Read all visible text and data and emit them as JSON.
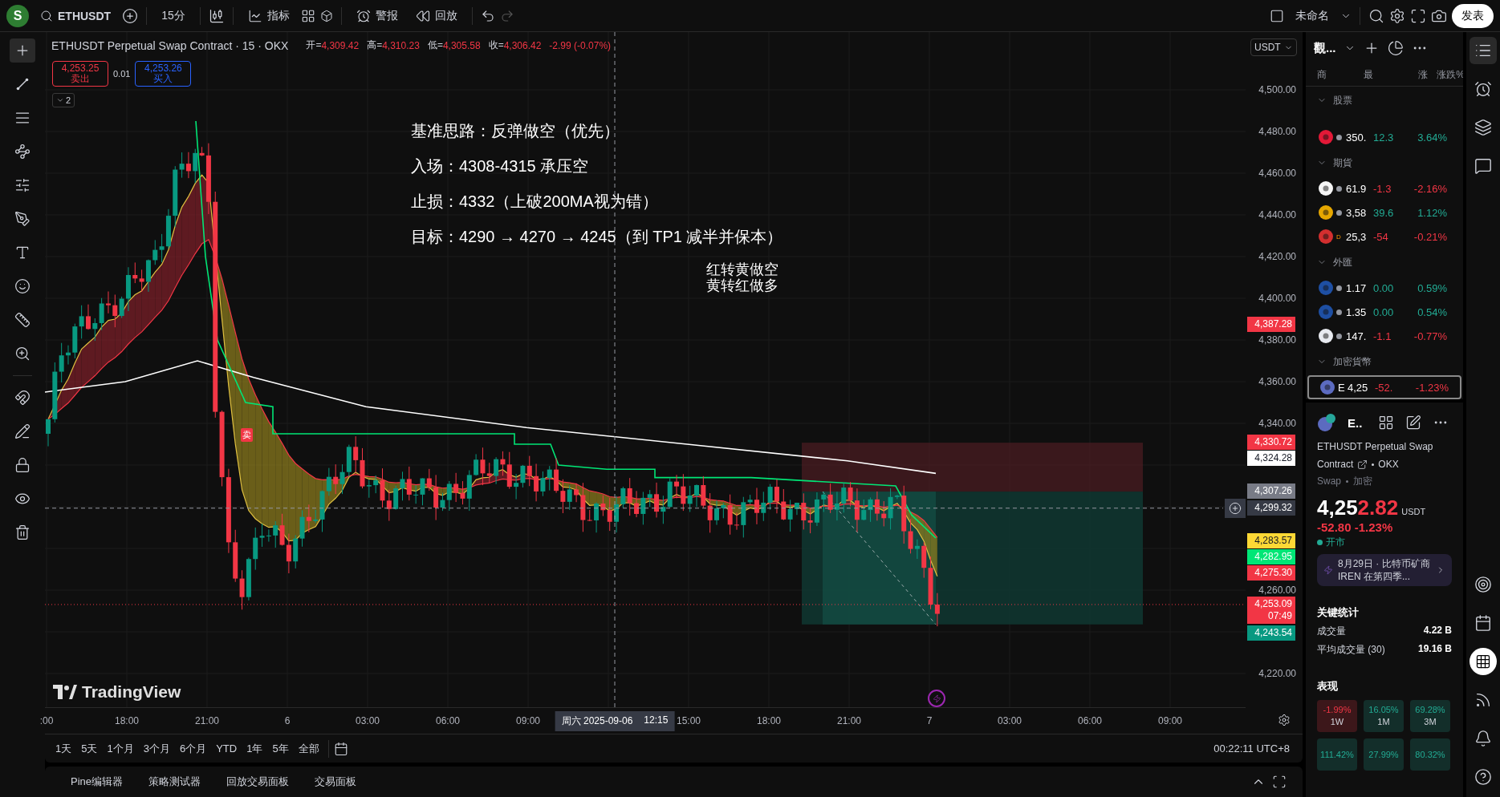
{
  "top_bar": {
    "avatar": "S",
    "symbol": "ETHUSDT",
    "interval": "15分",
    "indicators": "指标",
    "alert": "警报",
    "replay": "回放",
    "layout_name": "未命名",
    "publish": "发表"
  },
  "legend": {
    "title": "ETHUSDT Perpetual Swap Contract · 15 · OKX",
    "ohlc": [
      {
        "label": "开=",
        "value": "4,309.42"
      },
      {
        "label": "高=",
        "value": "4,310.23"
      },
      {
        "label": "低=",
        "value": "4,305.58"
      },
      {
        "label": "收=",
        "value": "4,306.42"
      }
    ],
    "change": "-2.99 (-0.07%)"
  },
  "trade": {
    "sell_price": "4,253.25",
    "sell_label": "卖出",
    "spread": "0.01",
    "buy_price": "4,253.26",
    "buy_label": "买入",
    "collapsed_count": "2"
  },
  "notes": [
    "基准思路：反弹做空（优先）",
    "入场：4308-4315 承压空",
    "止损：4332（上破200MA视为错）",
    "目标：4290 → 4270 → 4245（到 TP1 减半并保本）"
  ],
  "signal_note": [
    "红转黄做空",
    "黄转红做多"
  ],
  "sell_marker": "卖",
  "watermark_logo": "TradingView",
  "price_axis": {
    "currency": "USDT",
    "ticks": [
      "4,500.00",
      "4,480.00",
      "4,460.00",
      "4,440.00",
      "4,420.00",
      "4,400.00",
      "4,380.00",
      "4,360.00",
      "4,340.00",
      "4,260.00",
      "4,220.00"
    ],
    "badges": [
      {
        "price": "4,387.28",
        "color": "#f23645"
      },
      {
        "price": "4,330.72",
        "color": "#f23645"
      },
      {
        "price": "4,324.28",
        "color": "#ffffff"
      },
      {
        "price": "4,307.26",
        "color": "#787b86"
      },
      {
        "price": "4,299.32",
        "color": "#363a45"
      },
      {
        "price": "4,283.57",
        "color": "#fdd835"
      },
      {
        "price": "4,282.95",
        "color": "#00e676"
      },
      {
        "price": "4,275.30",
        "color": "#f23645"
      },
      {
        "price": "4,253.09",
        "sub": "07:49",
        "color": "#f23645"
      },
      {
        "price": "4,243.54",
        "color": "#089981"
      }
    ]
  },
  "time_axis": [
    {
      "label": ":00",
      "kind": "tick"
    },
    {
      "label": "18:00",
      "kind": "tick"
    },
    {
      "label": "21:00",
      "kind": "tick"
    },
    {
      "label": "6",
      "kind": "tick"
    },
    {
      "label": "03:00",
      "kind": "tick"
    },
    {
      "label": "06:00",
      "kind": "tick"
    },
    {
      "label": "09:00",
      "kind": "tick"
    },
    {
      "label": "周六 2025-09-06",
      "time": "12:15",
      "kind": "crosshair"
    },
    {
      "label": "15:00",
      "kind": "tick"
    },
    {
      "label": "18:00",
      "kind": "tick"
    },
    {
      "label": "21:00",
      "kind": "tick"
    },
    {
      "label": "7",
      "kind": "tick"
    },
    {
      "label": "03:00",
      "kind": "tick"
    },
    {
      "label": "06:00",
      "kind": "tick"
    },
    {
      "label": "09:00",
      "kind": "tick"
    }
  ],
  "ranges": [
    "1天",
    "5天",
    "1个月",
    "3个月",
    "6个月",
    "YTD",
    "1年",
    "5年",
    "全部"
  ],
  "clock": "00:22:11 UTC+8",
  "bottom_tabs": [
    "Pine编辑器",
    "策略测试器",
    "回放交易面板",
    "交易面板"
  ],
  "watchlist": {
    "title": "觀...",
    "columns": [
      "商",
      "最",
      "涨",
      "涨跌%"
    ],
    "sections": [
      {
        "name": "股票",
        "rows": [
          {
            "symbol": "",
            "last": "350.",
            "chg": "12.3",
            "pct": "3.64%",
            "color": "#22ab94",
            "selected": false
          }
        ]
      },
      {
        "name": "期貨",
        "rows": [
          {
            "symbol": "",
            "last": "61.9",
            "chg": "-1.3",
            "pct": "-2.16%",
            "color": "#f23645",
            "selected": false
          },
          {
            "symbol": "",
            "last": "3,58",
            "chg": "39.6",
            "pct": "1.12%",
            "color": "#22ab94",
            "selected": false
          },
          {
            "symbol": "",
            "flag": "D",
            "last": "25,3",
            "chg": "-54",
            "pct": "-0.21%",
            "color": "#f23645",
            "selected": false
          }
        ]
      },
      {
        "name": "外匯",
        "rows": [
          {
            "symbol": "",
            "last": "1.17",
            "chg": "0.00",
            "pct": "0.59%",
            "color": "#22ab94",
            "selected": false
          },
          {
            "symbol": "",
            "last": "1.35",
            "chg": "0.00",
            "pct": "0.54%",
            "color": "#22ab94",
            "selected": false
          },
          {
            "symbol": "",
            "last": "147.",
            "chg": "-1.1",
            "pct": "-0.77%",
            "color": "#f23645",
            "selected": false
          }
        ]
      },
      {
        "name": "加密貨幣",
        "rows": [
          {
            "symbol": "E",
            "last": "4,25",
            "chg": "-52.",
            "pct": "-1.23%",
            "color": "#f23645",
            "selected": true
          }
        ]
      }
    ]
  },
  "details": {
    "symbol": "E..",
    "name": "ETHUSDT Perpetual Swap",
    "name_2": "Contract",
    "exchange": "OKX",
    "type": "Swap",
    "category": "加密",
    "price_main": "4,25",
    "price_tail": "2.82",
    "currency": "USDT",
    "change": "-52.80  -1.23%",
    "status": "开市",
    "news": "8月29日 · 比特币矿商 IREN 在第四季...",
    "stats_title": "关键统计",
    "stats": [
      {
        "label": "成交量",
        "value": "4.22 B"
      },
      {
        "label": "平均成交量 (30)",
        "value": "19.16 B"
      }
    ],
    "performance_title": "表现",
    "performance": [
      {
        "value": "-1.99%",
        "period": "1W",
        "color": "#f23645"
      },
      {
        "value": "16.05%",
        "period": "1M",
        "color": "#22ab94"
      },
      {
        "value": "69.28%",
        "period": "3M",
        "color": "#22ab94"
      },
      {
        "value": "111.42%",
        "color": "#22ab94"
      },
      {
        "value": "27.99%",
        "color": "#22ab94"
      },
      {
        "value": "80.32%",
        "color": "#22ab94"
      }
    ]
  }
}
